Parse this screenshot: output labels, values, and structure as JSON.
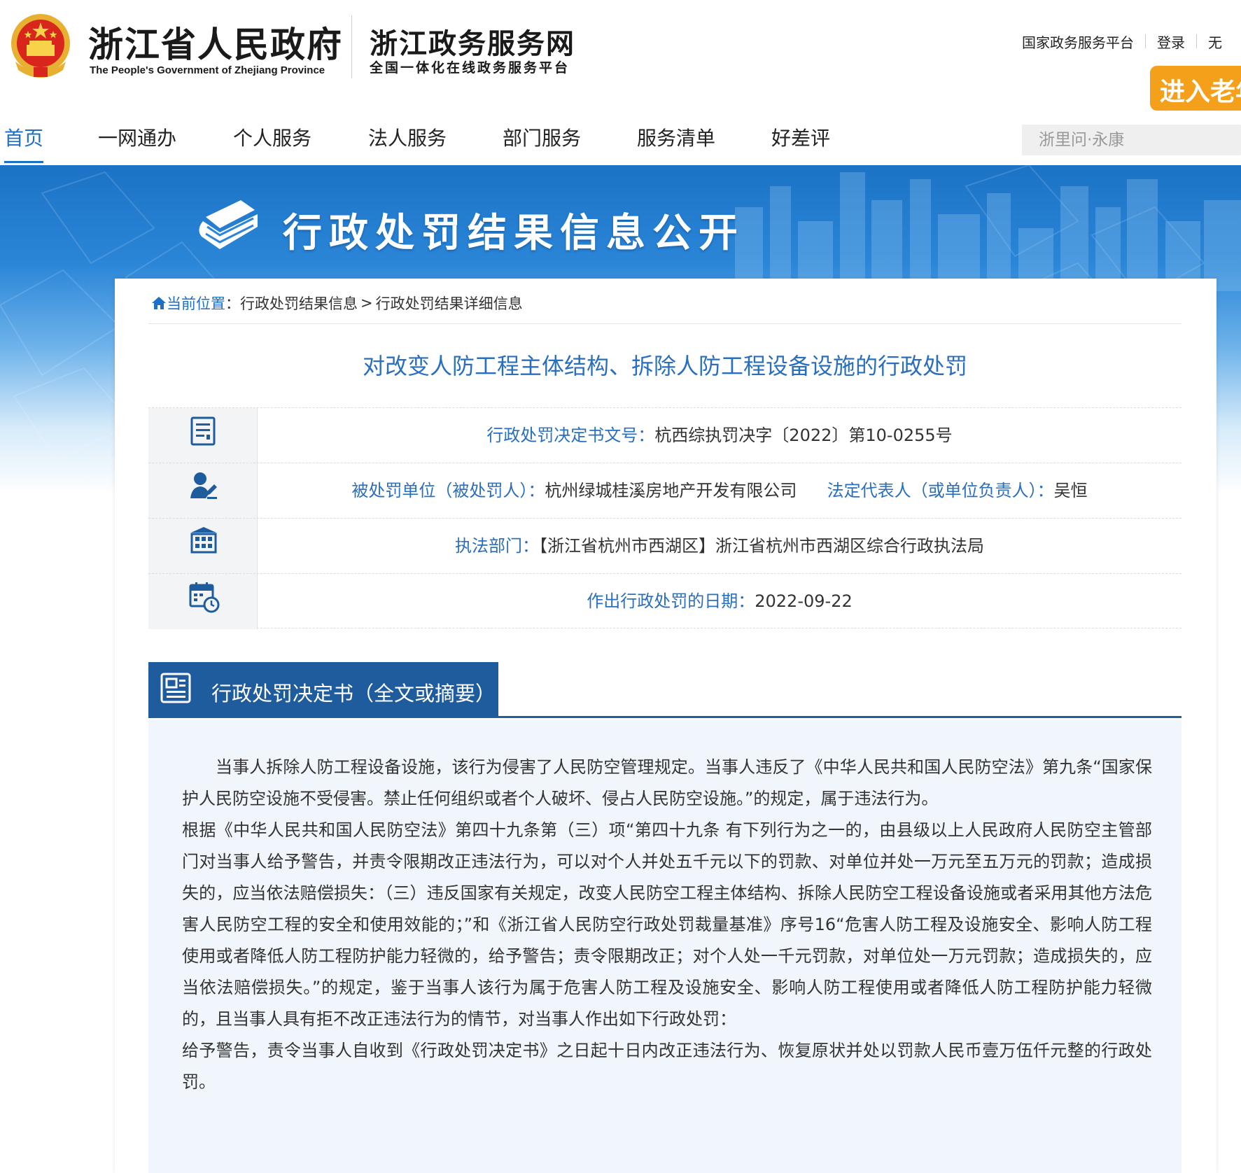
{
  "header": {
    "gov_title": "浙江省人民政府",
    "gov_subtitle": "The People's Government of Zhejiang Province",
    "service_title": "浙江政务服务网",
    "service_subtitle": "全国一体化在线政务服务平台",
    "links": [
      "国家政务服务平台",
      "登录",
      "无"
    ],
    "elder_mode_label": "进入老年",
    "colors": {
      "accent": "#1e6fc8",
      "elder_button": "#f5a01a"
    }
  },
  "nav": {
    "items": [
      "首页",
      "一网通办",
      "个人服务",
      "法人服务",
      "部门服务",
      "服务清单",
      "好差评"
    ],
    "active_index": 0,
    "search_placeholder": "浙里问·永康"
  },
  "banner": {
    "title": "行政处罚结果信息公开",
    "icon": "book-icon"
  },
  "breadcrumb": {
    "label": "当前位置",
    "separator": "：",
    "items": [
      "行政处罚结果信息",
      "行政处罚结果详细信息"
    ],
    "item_separator": ">"
  },
  "detail": {
    "title": "对改变人防工程主体结构、拆除人防工程设备设施的行政处罚",
    "rows": [
      {
        "icon": "document-icon",
        "label": "行政处罚决定书文号：",
        "value": "杭西综执罚决字〔2022〕第10-0255号"
      },
      {
        "icon": "person-icon",
        "label": "被处罚单位（被处罚人）：",
        "value": "杭州绿城桂溪房地产开发有限公司",
        "label2": "法定代表人（或单位负责人）：",
        "value2": "吴恒"
      },
      {
        "icon": "building-icon",
        "label": "执法部门：",
        "value": "【浙江省杭州市西湖区】浙江省杭州市西湖区综合行政执法局"
      },
      {
        "icon": "calendar-clock-icon",
        "label": "作出行政处罚的日期：",
        "value": "2022-09-22"
      }
    ]
  },
  "decision": {
    "section_title": "行政处罚决定书（全文或摘要）",
    "icon": "newspaper-icon",
    "paragraphs": [
      "当事人拆除人防工程设备设施，该行为侵害了人民防空管理规定。当事人违反了《中华人民共和国人民防空法》第九条“国家保护人民防空设施不受侵害。禁止任何组织或者个人破坏、侵占人民防空设施。”的规定，属于违法行为。",
      "根据《中华人民共和国人民防空法》第四十九条第（三）项“第四十九条 有下列行为之一的，由县级以上人民政府人民防空主管部门对当事人给予警告，并责令限期改正违法行为，可以对个人并处五千元以下的罚款、对单位并处一万元至五万元的罚款；造成损失的，应当依法赔偿损失：（三）违反国家有关规定，改变人民防空工程主体结构、拆除人民防空工程设备设施或者采用其他方法危害人民防空工程的安全和使用效能的；”和《浙江省人民防空行政处罚裁量基准》序号16“危害人防工程及设施安全、影响人防工程使用或者降低人防工程防护能力轻微的，给予警告；责令限期改正；对个人处一千元罚款，对单位处一万元罚款；造成损失的，应当依法赔偿损失。”的规定，鉴于当事人该行为属于危害人防工程及设施安全、影响人防工程使用或者降低人防工程防护能力轻微的，且当事人具有拒不改正违法行为的情节，对当事人作出如下行政处罚：",
      "给予警告，责令当事人自收到《行政处罚决定书》之日起十日内改正违法行为、恢复原状并处以罚款人民币壹万伍仟元整的行政处罚。"
    ]
  }
}
